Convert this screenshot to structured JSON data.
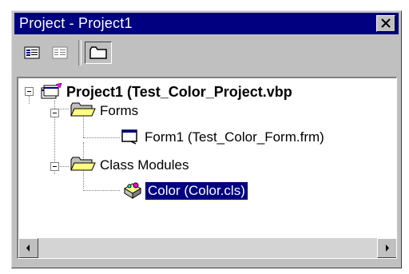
{
  "window": {
    "title": "Project - Project1"
  },
  "toolbar": {
    "buttons": [
      {
        "name": "View Code",
        "icon": "view-code-icon"
      },
      {
        "name": "View Object",
        "icon": "view-object-icon"
      },
      {
        "name": "Toggle Folders",
        "icon": "folder-icon",
        "pressed": true
      }
    ]
  },
  "tree": {
    "project": "Project1 (Test_Color_Project.vbp",
    "forms_folder": "Forms",
    "form1": "Form1 (Test_Color_Form.frm)",
    "class_folder": "Class Modules",
    "color_class": "Color (Color.cls)"
  },
  "colors": {
    "title_bar": "#000080",
    "selection": "#000080",
    "face": "#c0c0c0"
  }
}
